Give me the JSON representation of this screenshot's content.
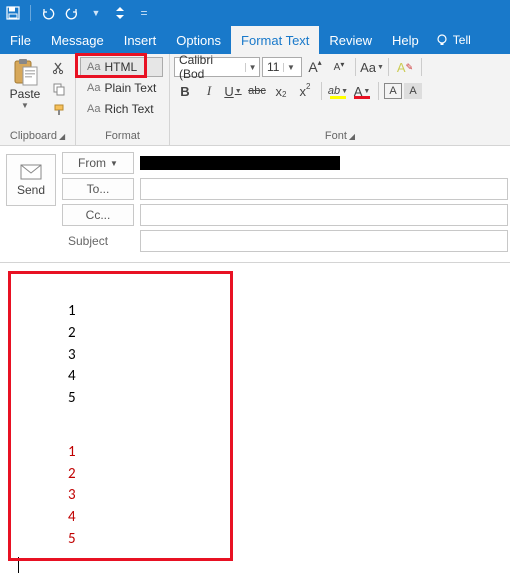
{
  "qat": {
    "save": "save",
    "undo": "undo",
    "redo": "redo"
  },
  "tabs": {
    "file": "File",
    "message": "Message",
    "insert": "Insert",
    "options": "Options",
    "format_text": "Format Text",
    "review": "Review",
    "help": "Help",
    "tell": "Tell"
  },
  "ribbon": {
    "clipboard": {
      "paste": "Paste",
      "label": "Clipboard"
    },
    "format": {
      "html": "HTML",
      "plain": "Plain Text",
      "rich": "Rich Text",
      "label": "Format"
    },
    "font": {
      "name": "Calibri (Bod",
      "size": "11",
      "label": "Font",
      "btns": {
        "bold": "B",
        "italic": "I",
        "underline": "U",
        "strike": "abc",
        "sub": "x",
        "sup": "x",
        "grow": "A",
        "shrink": "A",
        "case": "Aa",
        "clear": "A",
        "hl": "ab",
        "color": "A",
        "charborder": "A",
        "shading": "A"
      }
    }
  },
  "compose": {
    "send": "Send",
    "from": "From",
    "to": "To...",
    "cc": "Cc...",
    "subject_label": "Subject",
    "subject_value": ""
  },
  "body": {
    "list1": [
      "1",
      "2",
      "3",
      "4",
      "5"
    ],
    "list2": [
      "1",
      "2",
      "3",
      "4",
      "5"
    ]
  }
}
